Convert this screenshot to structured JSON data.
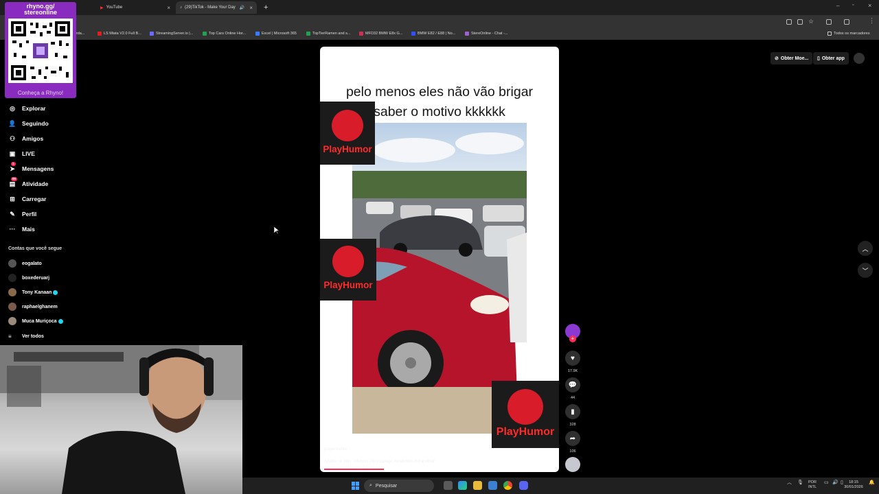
{
  "browser": {
    "tabs": [
      {
        "title": "YouTube"
      },
      {
        "title": "(29)TikTok - Make Your Day"
      }
    ],
    "bookmarks": [
      "zda...",
      "LS Miata V2.0 Full B...",
      "StreamingServer.io |...",
      "Top Cars Online Hor...",
      "Excel | Microsoft 365",
      "TopTierRamen and s...",
      "MFD32 BMW E8x G...",
      "BMW E82 / E88 | No...",
      "StereOnline - Chat -..."
    ],
    "all_bookmarks": "Todos os marcadores"
  },
  "overlay": {
    "url_line1": "rhyno.gg/",
    "url_line2": "stereonline",
    "caption": "Conheça a Rhyno!"
  },
  "sidebar": {
    "nav": [
      {
        "label": "Explorar",
        "icon": "compass-icon"
      },
      {
        "label": "Seguindo",
        "icon": "user-follow-icon"
      },
      {
        "label": "Amigos",
        "icon": "friends-icon"
      },
      {
        "label": "LIVE",
        "icon": "live-icon"
      },
      {
        "label": "Mensagens",
        "icon": "messages-icon",
        "badge": "1"
      },
      {
        "label": "Atividade",
        "icon": "activity-icon",
        "badge": "99"
      },
      {
        "label": "Carregar",
        "icon": "upload-icon"
      },
      {
        "label": "Perfil",
        "icon": "profile-icon"
      },
      {
        "label": "Mais",
        "icon": "more-icon"
      }
    ],
    "following_heading": "Contas que você segue",
    "accounts": [
      {
        "name": "eogalato",
        "verified": false,
        "color": "#555555"
      },
      {
        "name": "boxederuarj",
        "verified": false,
        "color": "#222222"
      },
      {
        "name": "Tony Kanaan",
        "verified": true,
        "color": "#8a6a4a"
      },
      {
        "name": "raphaelghanem",
        "verified": false,
        "color": "#7a5a4a"
      },
      {
        "name": "Muca Muriçoca",
        "verified": true,
        "color": "#9a8a7a"
      }
    ],
    "see_all": "Ver todos"
  },
  "video": {
    "caption_line1": "pelo menos eles não vão brigar",
    "caption_line2": "saber o motivo kkkkkk",
    "watermark": "PlayHumor",
    "author": "playerhumor",
    "description": "Ajudou os dois ..#foryou #foryoupage #viralvideo #viral #fnaf",
    "progress": 0.26
  },
  "actions": {
    "likes": "17.9K",
    "comments": "44",
    "saves": "328",
    "shares": "106"
  },
  "top_right": {
    "coins": "Obter Moe...",
    "app": "Obter app"
  },
  "taskbar": {
    "search_placeholder": "Pesquisar",
    "lang_line1": "POR",
    "lang_line2": "INTL",
    "time": "18:15",
    "date": "30/01/2026"
  },
  "colors": {
    "accent": "#fe2c55",
    "overlay_purple": "#8a2bbf"
  }
}
